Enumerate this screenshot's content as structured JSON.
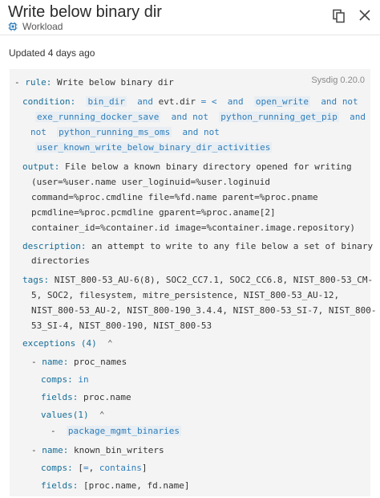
{
  "header": {
    "title": "Write below binary dir",
    "subtitle": "Workload"
  },
  "updated": "Updated 4 days ago",
  "rule": {
    "version": "Sysdig 0.20.0",
    "rule_key": "rule:",
    "rule_value": "Write below binary dir",
    "condition_key": "condition:",
    "condition": {
      "macro_bin_dir": "bin_dir",
      "and1": "and",
      "evt_dir": "evt.dir",
      "eq": "=",
      "lt": "<",
      "and2": "and",
      "macro_open_write": "open_write",
      "and3": "and",
      "not1": "not",
      "macro_docker_save": "exe_running_docker_save",
      "and4": "and",
      "not2": "not",
      "macro_pip": "python_running_get_pip",
      "and5": "and",
      "not3": "not",
      "macro_ms_oms": "python_running_ms_oms",
      "and6": "and",
      "not4": "not",
      "macro_user_known": "user_known_write_below_binary_dir_activities"
    },
    "output_key": "output:",
    "output_lines": [
      "File below a known binary directory opened for writing",
      "(user=%user.name user_loginuid=%user.loginuid",
      "command=%proc.cmdline file=%fd.name parent=%proc.pname",
      "pcmdline=%proc.pcmdline gparent=%proc.aname[2]",
      "container_id=%container.id image=%container.image.repository)"
    ],
    "description_key": "description:",
    "description_lines": [
      "an attempt to write to any file below a set of binary",
      "directories"
    ],
    "tags_key": "tags:",
    "tags_lines": [
      "NIST_800-53_AU-6(8), SOC2_CC7.1, SOC2_CC6.8, NIST_800-53_CM-",
      "5, SOC2, filesystem, mitre_persistence, NIST_800-53_AU-12,",
      "NIST_800-53_AU-2, NIST_800-190_3.4.4, NIST_800-53_SI-7, NIST_800-",
      "53_SI-4, NIST_800-190, NIST_800-53"
    ],
    "exceptions_label": "exceptions (4)",
    "exceptions": [
      {
        "dash": "-",
        "name_key": "name:",
        "name": "proc_names",
        "comps_key": "comps:",
        "comps": "in",
        "fields_key": "fields:",
        "fields": "proc.name",
        "values_label": "values(1)",
        "value_dash": "-",
        "value": "package_mgmt_binaries"
      },
      {
        "dash": "-",
        "name_key": "name:",
        "name": "known_bin_writers",
        "comps_key": "comps:",
        "comps_open": "[",
        "comps_a": "=",
        "comps_sep": ",",
        "comps_b": "contains",
        "comps_close": "]",
        "fields_key": "fields:",
        "fields": "[proc.name, fd.name]"
      }
    ]
  },
  "icons": {
    "workload": "cpu-chip-icon",
    "copy": "copy-icon",
    "close": "close-icon",
    "chevron": "chevron-up-icon"
  },
  "colors": {
    "keyword": "#166e98",
    "token": "#2e7dba",
    "panel_bg": "#f4f4f4"
  }
}
